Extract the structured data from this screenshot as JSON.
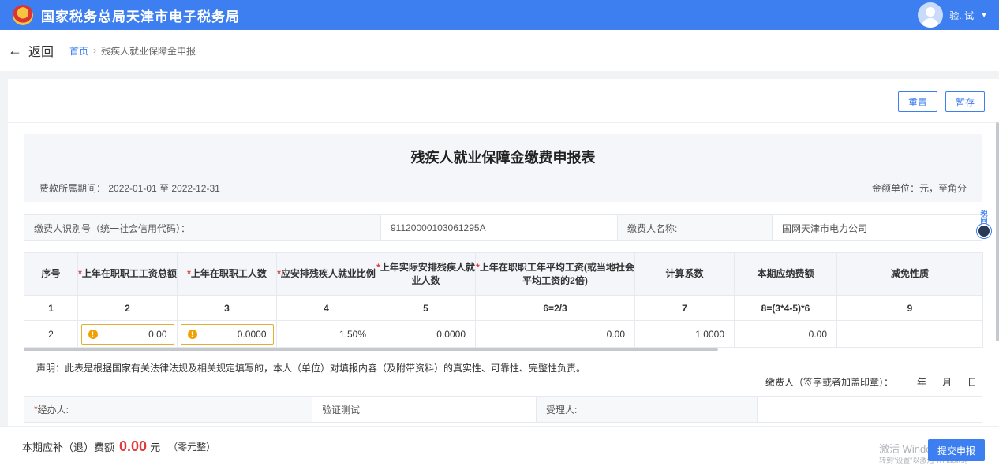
{
  "header": {
    "title": "国家税务总局天津市电子税务局",
    "user_name": "验..试",
    "colors": {
      "brand": "#3d7ef0"
    }
  },
  "nav": {
    "back_label": "返回",
    "breadcrumb": [
      "首页",
      "残疾人就业保障金申报"
    ]
  },
  "actions": {
    "reset": "重置",
    "save_draft": "暂存"
  },
  "form": {
    "title": "残疾人就业保障金缴费申报表",
    "period_label": "费款所属期间：",
    "period_value": "2022-01-01 至 2022-12-31",
    "unit": "金额单位：元，至角分",
    "payer_id_label": "缴费人识别号（统一社会信用代码）：",
    "payer_id_value": "91120000103061295A",
    "payer_name_label": "缴费人名称:",
    "payer_name_value": "国网天津市电力公司"
  },
  "table": {
    "headers": [
      {
        "text": "序号",
        "req": ""
      },
      {
        "text": "上年在职职工工资总额",
        "req": "*"
      },
      {
        "text": "上年在职职工人数",
        "req": "*"
      },
      {
        "text": "应安排残疾人就业比例",
        "req": "*"
      },
      {
        "text": "上年实际安排残疾人就业人数",
        "req": "*"
      },
      {
        "text": "上年在职职工年平均工资(或当地社会平均工资的2倍)",
        "req": "*"
      },
      {
        "text": "计算系数",
        "req": ""
      },
      {
        "text": "本期应纳费额",
        "req": ""
      },
      {
        "text": "减免性质",
        "req": ""
      }
    ],
    "index_row": [
      "1",
      "2",
      "3",
      "4",
      "5",
      "6=2/3",
      "7",
      "8=(3*4-5)*6",
      "9"
    ],
    "data_row": {
      "seq": "2",
      "total_wages": "0.00",
      "staff_count": "0.0000",
      "ratio": "1.50%",
      "disabled_count": "0.0000",
      "avg_wage": "0.00",
      "coefficient": "1.0000",
      "fee": "0.00",
      "reduction": ""
    }
  },
  "declaration": {
    "text": "声明：此表是根据国家有关法律法规及相关规定填写的，本人（单位）对填报内容（及附带资料）的真实性、可靠性、完整性负责。",
    "sign_label": "缴费人（签字或者加盖印章）：",
    "year": "年",
    "month": "月",
    "day": "日"
  },
  "signature": {
    "agent_req": "*",
    "agent_label": "经办人:",
    "agent_value": "验证测试",
    "receiver_label": "受理人:"
  },
  "assistant_text": "税问",
  "footer": {
    "label": "本期应补（退）费额",
    "amount": "0.00",
    "unit": "元",
    "words": "（零元整）",
    "submit": "提交申报",
    "watermark_line1": "激活 Windows",
    "watermark_line2": "转到\"设置\"以激活 Windows。"
  }
}
